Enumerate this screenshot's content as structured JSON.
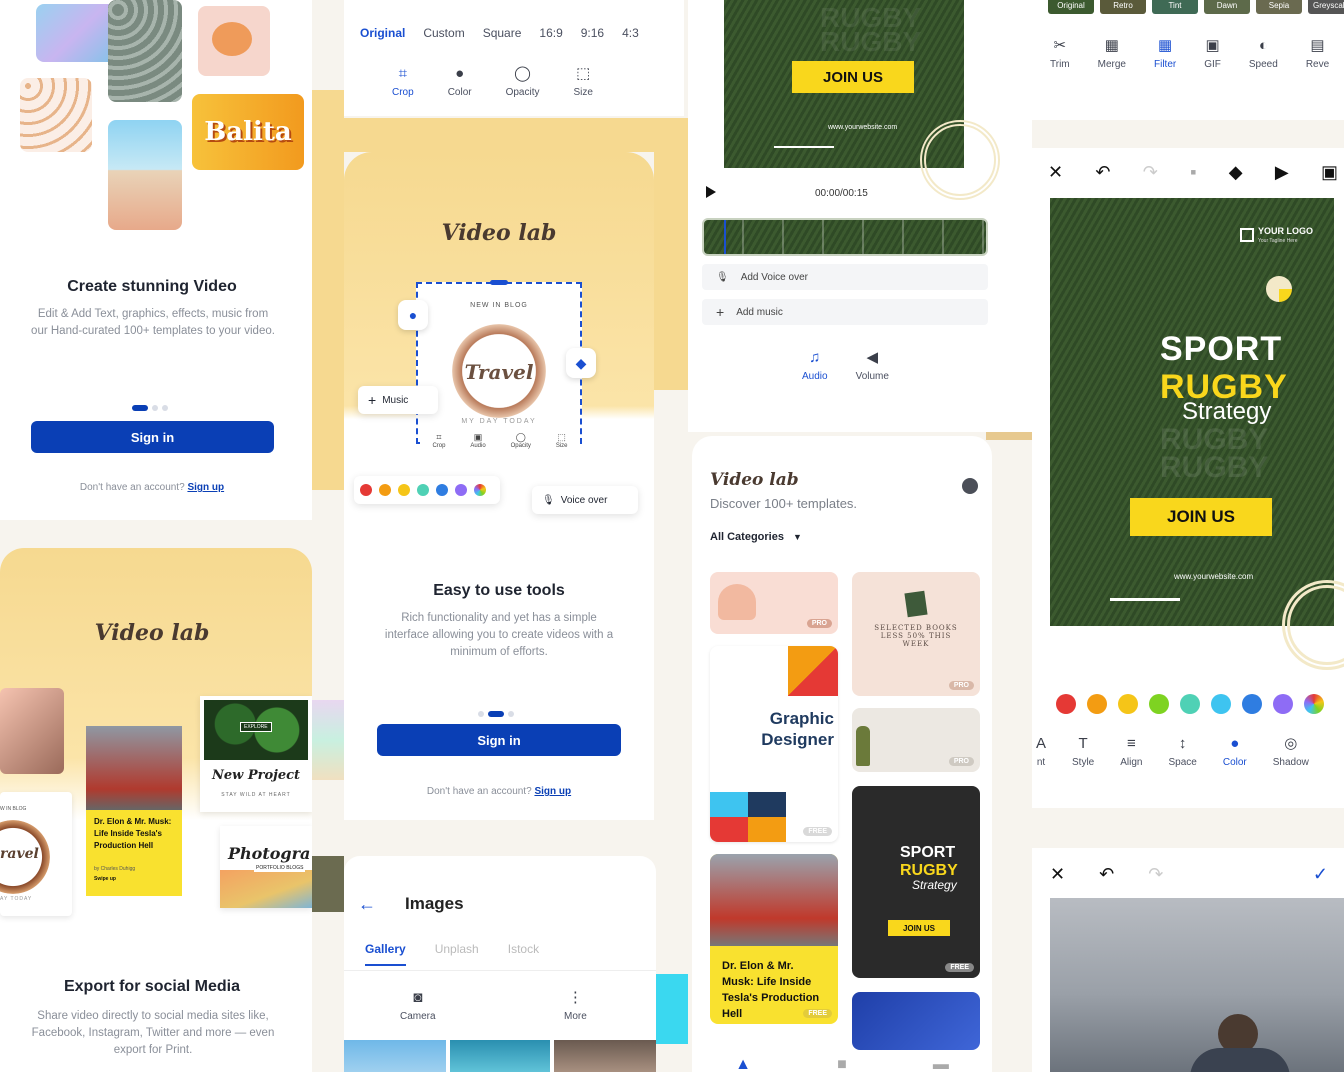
{
  "onboard1": {
    "sticker_text": "Balita",
    "title": "Create stunning Video",
    "body": "Edit & Add Text, graphics, effects, music from our Hand-curated 100+ templates to your video.",
    "signin": "Sign in",
    "no_account": "Don't have an account?",
    "signup": "Sign up"
  },
  "crop_screen": {
    "ratios": [
      "Original",
      "Custom",
      "Square",
      "16:9",
      "9:16",
      "4:3"
    ],
    "active_ratio": 0,
    "tools": [
      {
        "label": "Crop",
        "icon": "crop-icon"
      },
      {
        "label": "Color",
        "icon": "palette-icon"
      },
      {
        "label": "Opacity",
        "icon": "drop-icon"
      },
      {
        "label": "Size",
        "icon": "resize-icon"
      }
    ]
  },
  "rugby_preview": {
    "join": "JOIN US",
    "website": "www.yourwebsite.com",
    "timecode": "00:00/00:15",
    "voice_over": "Add Voice over",
    "music": "Add music",
    "tools": [
      {
        "label": "Audio",
        "icon": "audio-icon"
      },
      {
        "label": "Volume",
        "icon": "volume-icon"
      }
    ]
  },
  "filter_screen": {
    "filters": [
      "Original",
      "Retro",
      "Tint",
      "Dawn",
      "Sepia",
      "Greyscale"
    ],
    "tools": [
      {
        "label": "Trim",
        "icon": "scissors-icon"
      },
      {
        "label": "Merge",
        "icon": "merge-icon"
      },
      {
        "label": "Filter",
        "icon": "filter-icon"
      },
      {
        "label": "GIF",
        "icon": "gif-icon"
      },
      {
        "label": "Speed",
        "icon": "speed-icon"
      },
      {
        "label": "Reve",
        "icon": "reverse-icon"
      }
    ],
    "active_tool": 2
  },
  "editor": {
    "logo_title": "YOUR LOGO",
    "logo_sub": "Your Tagline Here",
    "line1": "SPORT",
    "line2": "RUGBY",
    "line3": "Strategy",
    "join": "JOIN US",
    "website": "www.yourwebsite.com",
    "colors": [
      "#e53935",
      "#f39c12",
      "#f5c518",
      "#7ed321",
      "#4fd1b5",
      "#3ec4f0",
      "#2f7de1",
      "#8e6cf5"
    ],
    "text_tools": [
      {
        "label": "nt",
        "icon": "font-icon"
      },
      {
        "label": "Style",
        "icon": "text-style-icon"
      },
      {
        "label": "Align",
        "icon": "align-icon"
      },
      {
        "label": "Space",
        "icon": "spacing-icon"
      },
      {
        "label": "Color",
        "icon": "color-icon"
      },
      {
        "label": "Shadow",
        "icon": "shadow-icon"
      }
    ],
    "active_text_tool": 4
  },
  "easy_tools": {
    "app_name": "Video lab",
    "card_top": "NEW IN BLOG",
    "card_script": "Travel",
    "card_bottom": "MY DAY TODAY",
    "mini_tools": [
      "Crop",
      "Audio",
      "Opacity",
      "Size"
    ],
    "music": "Music",
    "voice_over": "Voice over",
    "colors": [
      "#e53935",
      "#f39c12",
      "#f5c518",
      "#4fd1b5",
      "#2f7de1",
      "#8e6cf5"
    ],
    "title": "Easy to use tools",
    "body": "Rich functionality and yet has a simple interface allowing you to create videos with a minimum of efforts.",
    "signin": "Sign in",
    "no_account": "Don't have an account?",
    "signup": "Sign up"
  },
  "templates": {
    "app_name": "Video lab",
    "subtitle": "Discover 100+ templates.",
    "category": "All Categories",
    "books_title": "SELECTED BOOKS LESS 50% THIS WEEK",
    "designer": "Graphic Designer",
    "elon": "Dr. Elon & Mr. Musk: Life Inside Tesla's Production Hell",
    "sport1": "SPORT",
    "sport2": "RUGBY",
    "sport3": "Strategy",
    "join": "JOIN US",
    "tags": [
      "PRO",
      "PRO",
      "FREE",
      "PRO",
      "FREE",
      "FREE"
    ]
  },
  "export": {
    "app_name": "Video lab",
    "explore": "EXPLORE",
    "new_project": "New Project",
    "stay_wild": "STAY WILD AT HEART",
    "elon": "Dr. Elon & Mr. Musk: Life Inside Tesla's Production Hell",
    "elon_by": "by Charles Duhigg",
    "swipe": "Swipe up",
    "photo": "Photogra",
    "portfolio": "PORTFOLIO BLOGS",
    "blog": "W IN BLOG",
    "travel": "ravel",
    "today": "AY TODAY",
    "title": "Export for social Media",
    "body": "Share video directly to social media sites like, Facebook, Instagram, Twitter and more — even export for Print."
  },
  "images": {
    "title": "Images",
    "tabs": [
      "Gallery",
      "Unplash",
      "Istock"
    ],
    "active_tab": 0,
    "actions": [
      {
        "label": "Camera",
        "icon": "camera-icon"
      },
      {
        "label": "More",
        "icon": "more-icon"
      }
    ]
  }
}
